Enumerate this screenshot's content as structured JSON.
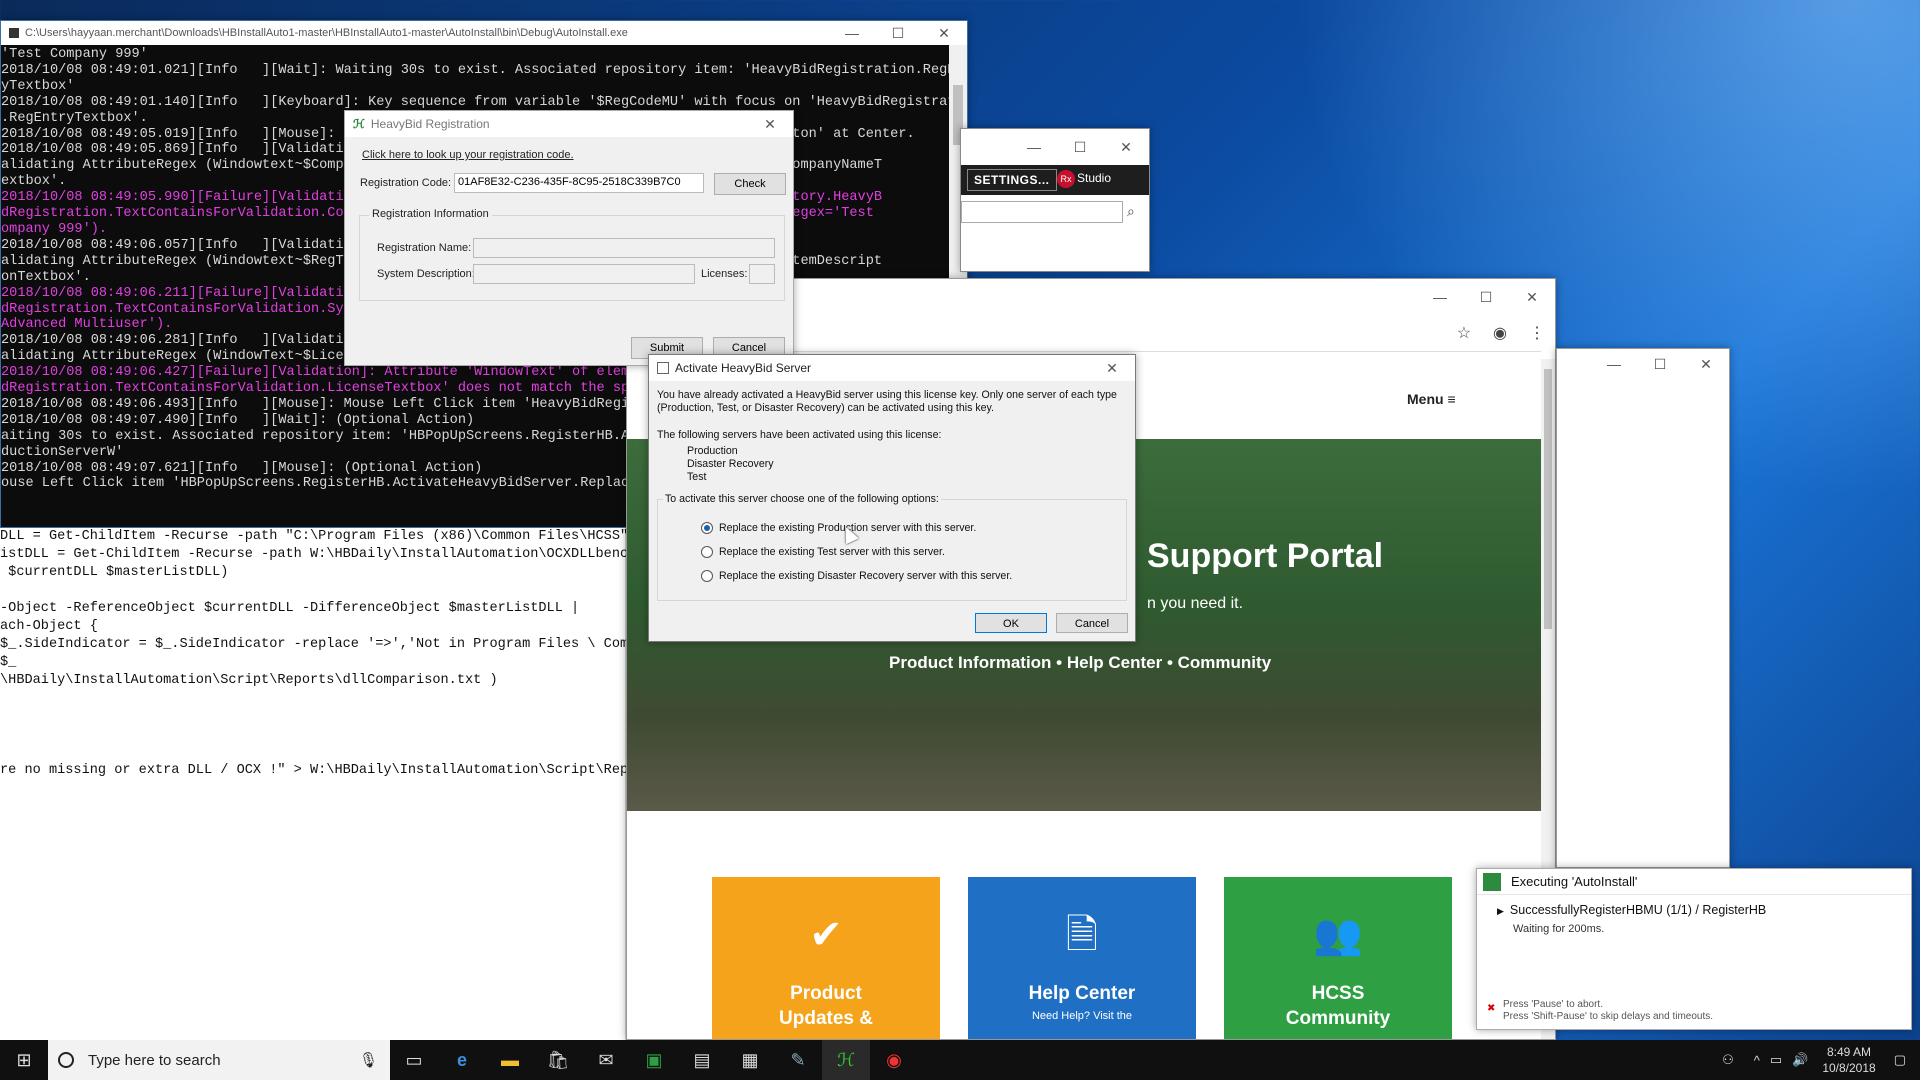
{
  "console": {
    "title": "C:\\Users\\hayyaan.merchant\\Downloads\\HBInstallAuto1-master\\HBInstallAuto1-master\\AutoInstall\\bin\\Debug\\AutoInstall.exe",
    "lines": [
      {
        "t": "'Test Company 999'",
        "fail": false
      },
      {
        "t": "2018/10/08 08:49:01.021][Info   ][Wait]: Waiting 30s to exist. Associated repository item: 'HeavyBidRegistration.RegEnt",
        "fail": false
      },
      {
        "t": "yTextbox'",
        "fail": false
      },
      {
        "t": "2018/10/08 08:49:01.140][Info   ][Keyboard]: Key sequence from variable '$RegCodeMU' with focus on 'HeavyBidRegistratio",
        "fail": false
      },
      {
        "t": ".RegEntryTextbox'.",
        "fail": false
      },
      {
        "t": "2018/10/08 08:49:05.019][Info   ][Mouse]: M                                                   Button' at Center.",
        "fail": false
      },
      {
        "t": "2018/10/08 08:49:05.869][Info   ][Validation",
        "fail": false
      },
      {
        "t": "alidating AttributeRegex (Windowtext~$Compan                                            idation.CompanyNameT",
        "fail": false
      },
      {
        "t": "extbox'.",
        "fail": false
      },
      {
        "t": "2018/10/08 08:49:05.990][Failure][Validation                                            allRepository.HeavyB",
        "fail": true
      },
      {
        "t": "dRegistration.TextContainsForValidation.Com                                             ual='', regex='Test",
        "fail": true
      },
      {
        "t": "ompany 999').",
        "fail": true
      },
      {
        "t": "2018/10/08 08:49:06.057][Info   ][Validation",
        "fail": false
      },
      {
        "t": "alidating AttributeRegex (Windowtext~$RegTyp                                            ation.SystemDescript",
        "fail": false
      },
      {
        "t": "onTextbox'.",
        "fail": false
      },
      {
        "t": "2018/10/08 08:49:06.211][Failure][Validation                                            allRepository.HeavyB",
        "fail": true
      },
      {
        "t": "dRegistration.TextContainsForValidation.Sys                                             x (actual='', regex=",
        "fail": true
      },
      {
        "t": "Advanced Multiuser').",
        "fail": true
      },
      {
        "t": "2018/10/08 08:49:06.281][Info   ][Validation",
        "fail": false
      },
      {
        "t": "alidating AttributeRegex (WindowText~$Licens",
        "fail": false
      },
      {
        "t": "",
        "fail": false
      },
      {
        "t": "2018/10/08 08:49:06.427][Failure][Validation]: Attribute 'WindowText' of element",
        "fail": true
      },
      {
        "t": "dRegistration.TextContainsForValidation.LicenseTextbox' does not match the specif",
        "fail": true
      },
      {
        "t": "2018/10/08 08:49:06.493][Info   ][Mouse]: Mouse Left Click item 'HeavyBidRegistra",
        "fail": false
      },
      {
        "t": "2018/10/08 08:49:07.490][Info   ][Wait]: (Optional Action)",
        "fail": false
      },
      {
        "t": "aiting 30s to exist. Associated repository item: 'HBPopUpScreens.RegisterHB.Activ",
        "fail": false
      },
      {
        "t": "ductionServerW'",
        "fail": false
      },
      {
        "t": "2018/10/08 08:49:07.621][Info   ][Mouse]: (Optional Action)",
        "fail": false
      },
      {
        "t": "ouse Left Click item 'HBPopUpScreens.RegisterHB.ActivateHeavyBidServer.ReplaceThe",
        "fail": false
      }
    ]
  },
  "editor": {
    "lines": [
      "DLL = Get-ChildItem -Recurse -path \"C:\\Program Files (x86)\\Common Files\\HCSS\"",
      "istDLL = Get-ChildItem -Recurse -path W:\\HBDaily\\InstallAutomation\\OCXDLLbenchm",
      " $currentDLL $masterListDLL)",
      "",
      "-Object -ReferenceObject $currentDLL -DifferenceObject $masterListDLL |",
      "ach-Object {",
      "$_.SideIndicator = $_.SideIndicator -replace '=>','Not in Program Files \\ Comm",
      "$_",
      "\\HBDaily\\InstallAutomation\\Script\\Reports\\dllComparison.txt )",
      "",
      "",
      "",
      "",
      "re no missing or extra DLL / OCX !\" > W:\\HBDaily\\InstallAutomation\\Script\\Repor"
    ]
  },
  "ranorex": {
    "settings_label": "SETTINGS...",
    "studio_label": "Studio",
    "logo_text": "Rx"
  },
  "browser": {
    "menu_label": "Menu",
    "hero_title": "Support Portal",
    "hero_sub": "n you need it.",
    "hero_links": "Product Information • Help Center • Community",
    "tiles": [
      {
        "label": "Product Updates &",
        "sub": "",
        "color": "#f5a31a"
      },
      {
        "label": "Help Center",
        "sub": "Need Help? Visit the",
        "color": "#1f6fc5"
      },
      {
        "label": "HCSS Community",
        "sub": "",
        "color": "#2ea043"
      }
    ]
  },
  "registration": {
    "title": "HeavyBid Registration",
    "lookup_link": "Click here to look up your registration code.",
    "code_label": "Registration Code:",
    "code_value": "01AF8E32-C236-435F-8C95-2518C339B7C0",
    "check_btn": "Check",
    "group_label": "Registration Information",
    "name_label": "Registration Name:",
    "desc_label": "System Description:",
    "licenses_label": "Licenses:",
    "submit_btn": "Submit",
    "cancel_btn": "Cancel"
  },
  "activate": {
    "title": "Activate HeavyBid Server",
    "msg1": "You have already activated a HeavyBid server using this license key. Only one server of each type (Production, Test, or Disaster Recovery) can be activated using this key.",
    "msg2": "The following servers have been activated using this license:",
    "servers": [
      "Production",
      "Disaster Recovery",
      "Test"
    ],
    "options_label": "To activate this server choose one of the following options:",
    "options": [
      {
        "label": "Replace the existing Production server with this server.",
        "selected": true
      },
      {
        "label": "Replace the existing Test server with this server.",
        "selected": false
      },
      {
        "label": "Replace the existing Disaster Recovery server with this server.",
        "selected": false
      }
    ],
    "ok_btn": "OK",
    "cancel_btn": "Cancel"
  },
  "toast": {
    "title": "Executing 'AutoInstall'",
    "step": "SuccessfullyRegisterHBMU (1/1) / RegisterHB",
    "status": "Waiting for 200ms.",
    "hint1": "Press 'Pause' to abort.",
    "hint2": "Press 'Shift-Pause' to skip delays and timeouts."
  },
  "taskbar": {
    "search_placeholder": "Type here to search",
    "time": "8:49 AM",
    "date": "10/8/2018"
  }
}
